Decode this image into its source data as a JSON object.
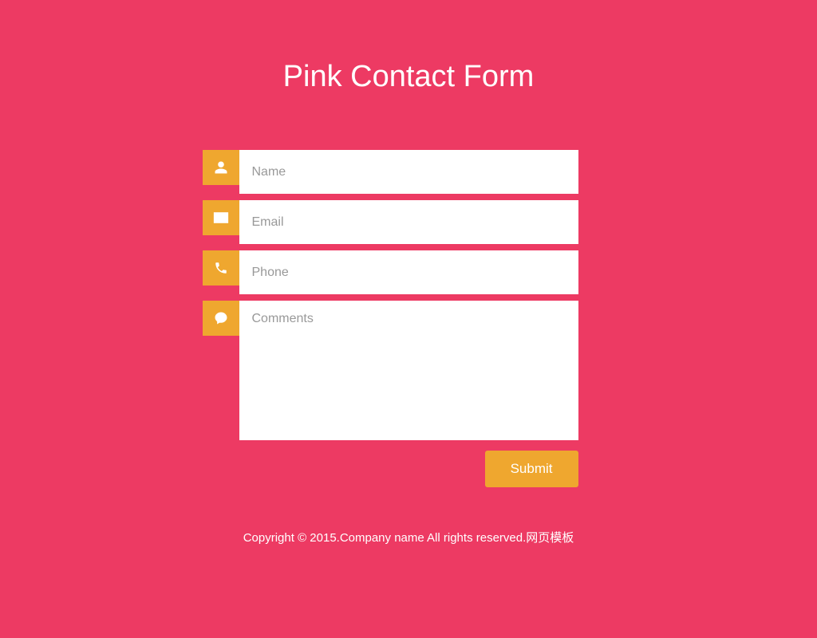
{
  "title": "Pink Contact Form",
  "form": {
    "name_placeholder": "Name",
    "email_placeholder": "Email",
    "phone_placeholder": "Phone",
    "comments_placeholder": "Comments",
    "submit_label": "Submit"
  },
  "footer": {
    "text": "Copyright © 2015.Company name All rights reserved.",
    "link_text": "网页模板"
  },
  "colors": {
    "background": "#ed3a63",
    "accent": "#efa72f"
  }
}
